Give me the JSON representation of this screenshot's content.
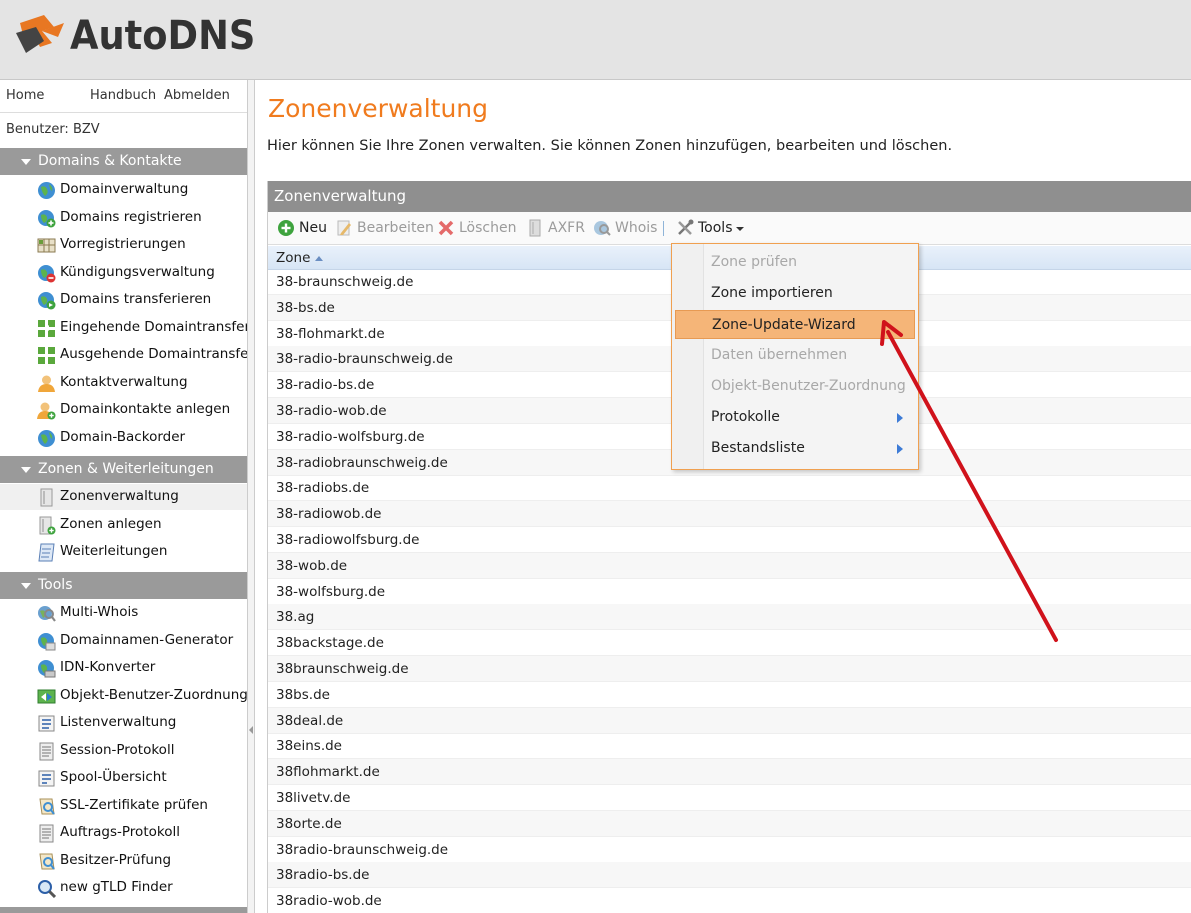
{
  "header": {
    "brand": "AutoDNS"
  },
  "topnav": {
    "home": "Home",
    "manual": "Handbuch",
    "logout": "Abmelden"
  },
  "user": {
    "label": "Benutzer: BZV"
  },
  "sections": {
    "domains": {
      "title": "Domains & Kontakte",
      "items": [
        {
          "label": "Domainverwaltung",
          "icon": "globe-icon"
        },
        {
          "label": "Domains registrieren",
          "icon": "globe-add-icon"
        },
        {
          "label": "Vorregistrierungen",
          "icon": "grid-icon"
        },
        {
          "label": "Kündigungsverwaltung",
          "icon": "globe-remove-icon"
        },
        {
          "label": "Domains transferieren",
          "icon": "globe-transfer-icon"
        },
        {
          "label": "Eingehende Domaintransfers",
          "icon": "transfer-in-icon"
        },
        {
          "label": "Ausgehende Domaintransfers",
          "icon": "transfer-out-icon"
        },
        {
          "label": "Kontaktverwaltung",
          "icon": "contact-icon"
        },
        {
          "label": "Domainkontakte anlegen",
          "icon": "contact-add-icon"
        },
        {
          "label": "Domain-Backorder",
          "icon": "globe-icon"
        }
      ]
    },
    "zones": {
      "title": "Zonen & Weiterleitungen",
      "items": [
        {
          "label": "Zonenverwaltung",
          "icon": "zone-icon"
        },
        {
          "label": "Zonen anlegen",
          "icon": "zone-add-icon"
        },
        {
          "label": "Weiterleitungen",
          "icon": "redirect-icon"
        }
      ]
    },
    "tools": {
      "title": "Tools",
      "items": [
        {
          "label": "Multi-Whois",
          "icon": "whois-icon"
        },
        {
          "label": "Domainnamen-Generator",
          "icon": "generator-icon"
        },
        {
          "label": "IDN-Konverter",
          "icon": "idn-icon"
        },
        {
          "label": "Objekt-Benutzer-Zuordnung",
          "icon": "object-user-icon"
        },
        {
          "label": "Listenverwaltung",
          "icon": "list-icon"
        },
        {
          "label": "Session-Protokoll",
          "icon": "log-icon"
        },
        {
          "label": "Spool-Übersicht",
          "icon": "spool-icon"
        },
        {
          "label": "SSL-Zertifikate prüfen",
          "icon": "ssl-icon"
        },
        {
          "label": "Auftrags-Protokoll",
          "icon": "log-icon"
        },
        {
          "label": "Besitzer-Prüfung",
          "icon": "owner-check-icon"
        },
        {
          "label": "new gTLD Finder",
          "icon": "magnifier-icon"
        }
      ]
    }
  },
  "main": {
    "title": "Zonenverwaltung",
    "description": "Hier können Sie Ihre Zonen verwalten. Sie können Zonen hinzufügen, bearbeiten und löschen.",
    "panel_title": "Zonenverwaltung",
    "toolbar": {
      "new": "Neu",
      "edit": "Bearbeiten",
      "delete": "Löschen",
      "axfr": "AXFR",
      "whois": "Whois",
      "tools": "Tools"
    },
    "column": "Zone",
    "zones": [
      "38-braunschweig.de",
      "38-bs.de",
      "38-flohmarkt.de",
      "38-radio-braunschweig.de",
      "38-radio-bs.de",
      "38-radio-wob.de",
      "38-radio-wolfsburg.de",
      "38-radiobraunschweig.de",
      "38-radiobs.de",
      "38-radiowob.de",
      "38-radiowolfsburg.de",
      "38-wob.de",
      "38-wolfsburg.de",
      "38.ag",
      "38backstage.de",
      "38braunschweig.de",
      "38bs.de",
      "38deal.de",
      "38eins.de",
      "38flohmarkt.de",
      "38livetv.de",
      "38orte.de",
      "38radio-braunschweig.de",
      "38radio-bs.de",
      "38radio-wob.de"
    ]
  },
  "tools_menu": {
    "items": [
      {
        "label": "Zone prüfen",
        "state": "disabled"
      },
      {
        "label": "Zone importieren",
        "state": "enabled"
      },
      {
        "label": "Zone-Update-Wizard",
        "state": "highlighted"
      },
      {
        "label": "Daten übernehmen",
        "state": "disabled"
      },
      {
        "label": "Objekt-Benutzer-Zuordnung",
        "state": "disabled"
      },
      {
        "label": "Protokolle",
        "state": "submenu"
      },
      {
        "label": "Bestandsliste",
        "state": "submenu"
      }
    ]
  },
  "colors": {
    "accent": "#f07b1e",
    "section_header": "#9a9a9a",
    "menu_highlight": "#f5b578",
    "annotation_arrow": "#d0121b"
  }
}
